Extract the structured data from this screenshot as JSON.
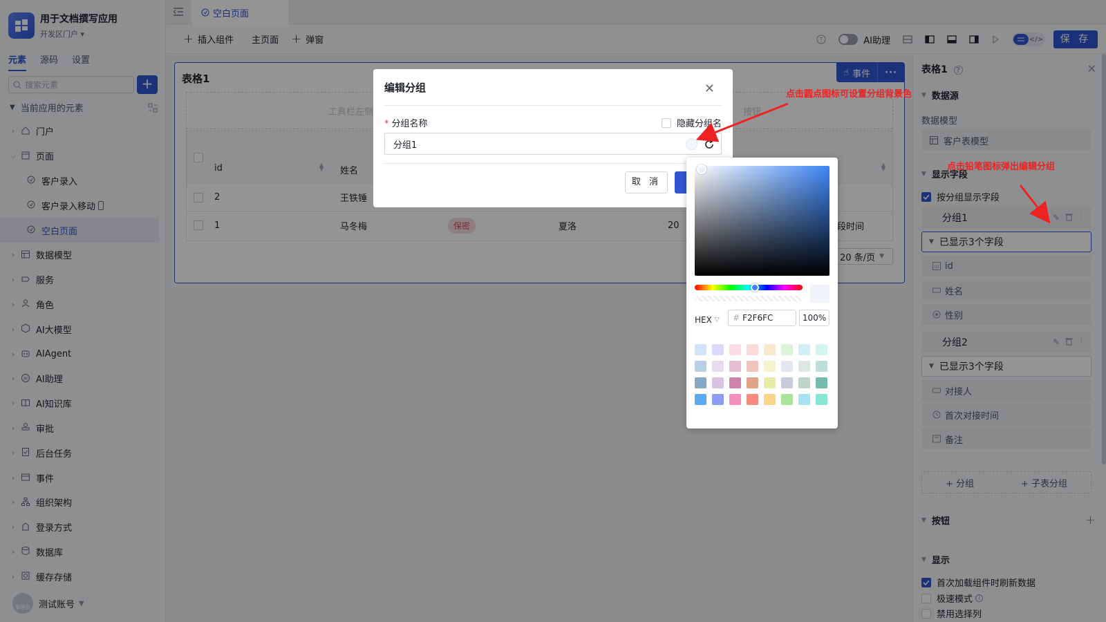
{
  "app": {
    "name": "用于文档撰写应用",
    "env": "开发区门户"
  },
  "side_tabs": [
    "元素",
    "源码",
    "设置"
  ],
  "search": {
    "placeholder": "搜索元素"
  },
  "tree_head": "当前应用的元素",
  "tree": [
    {
      "label": "门户",
      "icon": "home-icon",
      "level": 0,
      "expanded": false
    },
    {
      "label": "页面",
      "icon": "page-icon",
      "level": 0,
      "expanded": true
    },
    {
      "label": "客户录入",
      "icon": "page-link-icon",
      "level": 1
    },
    {
      "label": "客户录入移动",
      "icon": "page-link-icon",
      "level": 1
    },
    {
      "label": "空白页面",
      "icon": "page-link-icon",
      "level": 1,
      "selected": true
    },
    {
      "label": "数据模型",
      "icon": "table-icon",
      "level": 0
    },
    {
      "label": "服务",
      "icon": "service-icon",
      "level": 0
    },
    {
      "label": "角色",
      "icon": "role-icon",
      "level": 0
    },
    {
      "label": "AI大模型",
      "icon": "ai-model-icon",
      "level": 0
    },
    {
      "label": "AIAgent",
      "icon": "robot-icon",
      "level": 0
    },
    {
      "label": "AI助理",
      "icon": "ai-assistant-icon",
      "level": 0
    },
    {
      "label": "AI知识库",
      "icon": "book-icon",
      "level": 0
    },
    {
      "label": "审批",
      "icon": "stamp-icon",
      "level": 0
    },
    {
      "label": "后台任务",
      "icon": "task-icon",
      "level": 0
    },
    {
      "label": "事件",
      "icon": "event-icon",
      "level": 0
    },
    {
      "label": "组织架构",
      "icon": "org-icon",
      "level": 0
    },
    {
      "label": "登录方式",
      "icon": "login-icon",
      "level": 0
    },
    {
      "label": "数据库",
      "icon": "database-icon",
      "level": 0
    },
    {
      "label": "缓存存储",
      "icon": "cache-icon",
      "level": 0
    }
  ],
  "account": {
    "name": "测试账号",
    "avatar_text": "管理员"
  },
  "tab": {
    "label": "空白页面"
  },
  "toolbar": {
    "insert": "插入组件",
    "main_page": "主页面",
    "popup": "弹窗",
    "ai_toggle": "AI助理",
    "save": "保 存"
  },
  "component": {
    "title": "表格1",
    "event_btn": "事件",
    "toolbar_placeholder": "工具栏左侧",
    "toolbar_placeholder_right": "按钮",
    "header_extra": "2",
    "columns": [
      "id",
      "姓名"
    ],
    "rows": [
      {
        "id": "2",
        "name": "王铁锤"
      },
      {
        "id": "1",
        "name": "马冬梅",
        "tag": "保密",
        "contact": "夏洛",
        "date": "20",
        "note": "一段时间"
      }
    ],
    "pager": "20 条/页"
  },
  "right_panel": {
    "title": "表格1",
    "datasource_label": "数据源",
    "model_label": "数据模型",
    "model_value": "客户表模型",
    "fields_label": "显示字段",
    "by_group": "按分组显示字段",
    "groups": [
      {
        "name": "分组1",
        "shown": "已显示3个字段",
        "fields": [
          {
            "label": "id",
            "icon": "id-icon"
          },
          {
            "label": "姓名",
            "icon": "text-field-icon"
          },
          {
            "label": "性别",
            "icon": "radio-icon"
          }
        ]
      },
      {
        "name": "分组2",
        "shown": "已显示3个字段",
        "fields": [
          {
            "label": "对接人",
            "icon": "text-field-icon"
          },
          {
            "label": "首次对接时间",
            "icon": "clock-icon"
          },
          {
            "label": "备注",
            "icon": "textarea-icon"
          }
        ]
      }
    ],
    "add_group": "分组",
    "add_subgroup": "子表分组",
    "buttons_label": "按钮",
    "display_label": "显示",
    "opt_refresh": "首次加载组件时刷新数据",
    "opt_fast": "极速模式",
    "opt_cut": "禁用选择列"
  },
  "modal": {
    "title": "编辑分组",
    "name_label": "分组名称",
    "required_mark": "*",
    "hide_label": "隐藏分组名",
    "name_value": "分组1",
    "cancel": "取 消"
  },
  "color_picker": {
    "mode": "HEX",
    "hash": "#",
    "hex_value": "F2F6FC",
    "alpha": "100%",
    "current_color": "#F2F6FC",
    "swatches": [
      "#cfe4fb",
      "#dcdafb",
      "#fbdbe6",
      "#fbd9d9",
      "#fbe7cb",
      "#dcf2d9",
      "#d2eef6",
      "#d4f4ee",
      "#b9cfe6",
      "#e7dcef",
      "#e8bcd3",
      "#eec4bc",
      "#f6f2cd",
      "#e3e6ee",
      "#dde8e2",
      "#bddfdb",
      "#86a6c8",
      "#d9c2e2",
      "#cf82ac",
      "#e0a289",
      "#e8eba5",
      "#c7cbda",
      "#bdd4c8",
      "#76b9ad",
      "#5ba9f2",
      "#8e9cf4",
      "#f28fbb",
      "#f58b80",
      "#fbd688",
      "#a9e49a",
      "#a6e2f1",
      "#86e4d2"
    ]
  },
  "annotations": {
    "a1": "点击圆点图标可设置分组背景色",
    "a2": "点击铅笔图标弹出编辑分组"
  },
  "colors": {
    "accent": "#3056d3",
    "annotation": "#ee2222",
    "tag_bg": "#f7d9dd"
  }
}
